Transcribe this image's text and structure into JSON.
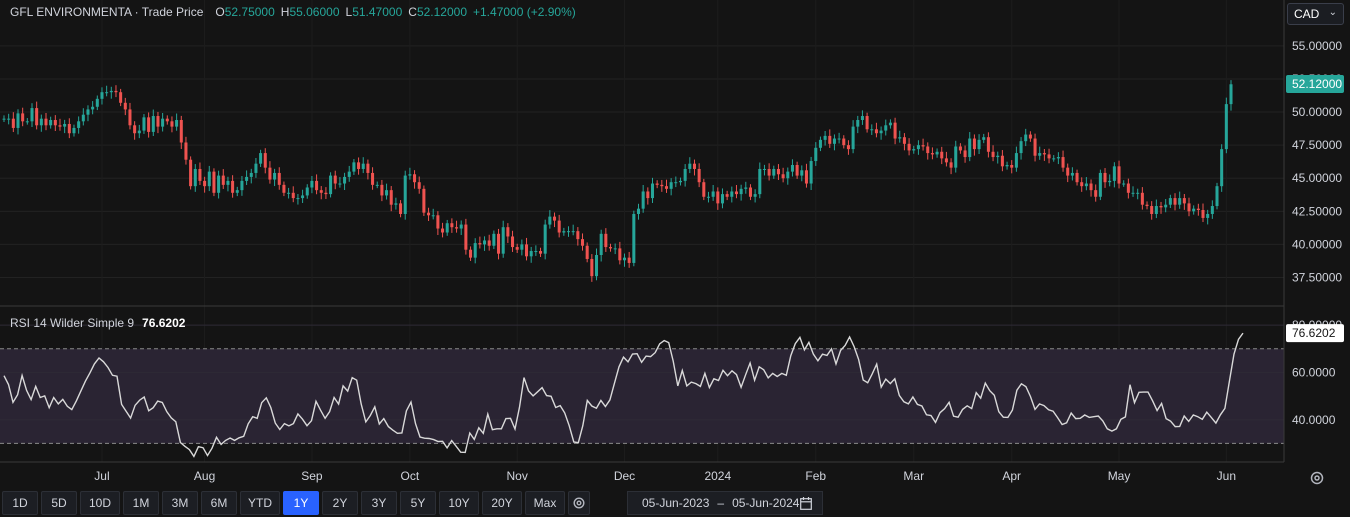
{
  "legend": {
    "name": "GFL ENVIRONMENTA · Trade Price",
    "o_label": "O",
    "o": "52.75000",
    "h_label": "H",
    "h": "55.06000",
    "l_label": "L",
    "l": "51.47000",
    "c_label": "C",
    "c": "52.12000",
    "change": "+1.47000 (+2.90%)"
  },
  "currency": {
    "selected": "CAD"
  },
  "rsi_legend": {
    "name": "RSI 14 Wilder Simple 9",
    "value": "76.6202"
  },
  "colors": {
    "up": "#26a69a",
    "down": "#ef5350",
    "rsi_line": "#d9d9d9",
    "rsi_band": "#2a2433",
    "background": "#141414",
    "grid": "#222222"
  },
  "toolbar": {
    "ranges": [
      "1D",
      "5D",
      "10D",
      "1M",
      "3M",
      "6M",
      "YTD",
      "1Y",
      "2Y",
      "3Y",
      "5Y",
      "10Y",
      "20Y",
      "Max"
    ],
    "active": "1Y",
    "settings_icon": "gear-icon",
    "date_from": "05-Jun-2023",
    "date_sep": "–",
    "date_to": "05-Jun-2024",
    "calendar_icon": "calendar-icon"
  },
  "chart_data": [
    {
      "type": "candlestick",
      "title": "GFL ENVIRONMENTA · Trade Price",
      "y_ticks": [
        "55.00000",
        "52.50000",
        "50.00000",
        "47.50000",
        "45.00000",
        "42.50000",
        "40.00000",
        "37.50000"
      ],
      "y_tick_values": [
        55,
        52.5,
        50,
        47.5,
        45,
        42.5,
        40,
        37.5
      ],
      "ylim": [
        35.8,
        56.2
      ],
      "last_price_label": "52.12000",
      "last_price": 52.12,
      "x_ticks": [
        "Jul",
        "Aug",
        "Sep",
        "Oct",
        "Nov",
        "Dec",
        "2024",
        "Feb",
        "Mar",
        "Apr",
        "May",
        "Jun"
      ],
      "x_tick_index": [
        21,
        43,
        66,
        87,
        110,
        133,
        153,
        174,
        195,
        216,
        239,
        262
      ],
      "close": [
        49.5,
        49.5,
        48.8,
        49.9,
        49.3,
        49.3,
        50.3,
        49.0,
        49.5,
        49.0,
        49.4,
        49.0,
        48.9,
        49.1,
        48.4,
        48.8,
        49.3,
        49.8,
        50.2,
        50.4,
        51.0,
        51.5,
        51.5,
        51.6,
        51.5,
        50.7,
        50.2,
        49.0,
        48.4,
        48.6,
        49.6,
        48.5,
        49.7,
        48.9,
        49.5,
        49.3,
        48.9,
        49.4,
        47.7,
        46.4,
        44.4,
        45.7,
        44.8,
        44.4,
        45.5,
        43.9,
        45.2,
        44.5,
        44.8,
        43.9,
        44.1,
        44.8,
        45.1,
        45.4,
        46.1,
        46.9,
        45.8,
        44.9,
        45.4,
        44.5,
        43.9,
        43.9,
        43.5,
        43.5,
        43.7,
        44.3,
        44.8,
        44.1,
        43.9,
        43.8,
        45.2,
        44.6,
        44.6,
        45.1,
        45.5,
        46.2,
        45.7,
        46.1,
        45.4,
        44.5,
        44.5,
        43.7,
        44.1,
        43.0,
        43.1,
        42.3,
        45.2,
        45.3,
        44.7,
        44.2,
        42.4,
        42.2,
        42.2,
        41.2,
        40.9,
        41.6,
        41.3,
        41.2,
        41.5,
        39.6,
        39.0,
        40.1,
        40.0,
        40.3,
        39.9,
        40.8,
        39.3,
        41.3,
        40.6,
        39.8,
        39.6,
        40.0,
        39.1,
        39.5,
        39.5,
        39.3,
        41.5,
        42.1,
        41.8,
        40.9,
        41.0,
        41.0,
        41.0,
        40.4,
        39.9,
        38.9,
        37.6,
        39.2,
        40.8,
        39.8,
        39.7,
        39.7,
        38.8,
        39.0,
        38.6,
        42.3,
        42.7,
        44.0,
        43.5,
        44.6,
        44.5,
        44.4,
        44.2,
        44.7,
        44.7,
        44.8,
        45.7,
        46.1,
        45.7,
        44.7,
        43.6,
        43.6,
        44.0,
        43.1,
        43.8,
        43.6,
        44.0,
        43.8,
        44.2,
        44.3,
        43.6,
        43.8,
        45.7,
        45.7,
        45.2,
        45.7,
        45.3,
        45.0,
        45.5,
        46.0,
        45.2,
        45.6,
        44.6,
        46.3,
        47.3,
        47.9,
        48.2,
        47.6,
        48.0,
        48.0,
        47.5,
        47.2,
        48.9,
        49.4,
        49.7,
        48.7,
        48.7,
        48.4,
        48.6,
        49.0,
        49.2,
        48.0,
        48.1,
        47.6,
        47.1,
        47.2,
        47.5,
        47.4,
        46.9,
        46.8,
        47.0,
        46.5,
        46.2,
        45.8,
        47.4,
        47.1,
        46.6,
        48.0,
        47.2,
        47.9,
        48.1,
        47.0,
        46.6,
        46.7,
        45.9,
        46.0,
        45.8,
        46.9,
        47.8,
        48.3,
        48.0,
        46.7,
        46.9,
        46.8,
        46.5,
        46.5,
        46.6,
        45.8,
        45.2,
        45.4,
        44.7,
        44.4,
        44.6,
        44.1,
        43.6,
        45.4,
        44.7,
        44.8,
        45.9,
        44.6,
        44.6,
        43.9,
        43.9,
        43.9,
        43.0,
        42.9,
        42.3,
        42.9,
        42.8,
        43.0,
        43.5,
        43.0,
        43.5,
        43.1,
        42.5,
        42.7,
        42.6,
        42.0,
        42.3,
        42.9,
        44.4,
        47.2,
        50.6,
        52.1
      ]
    },
    {
      "type": "line",
      "title": "RSI 14 Wilder Simple 9",
      "value_label": "76.6202",
      "y_ticks": [
        "80.00000",
        "60.0000",
        "40.0000"
      ],
      "y_tick_values": [
        80,
        60,
        40
      ],
      "ylim": [
        23,
        83
      ],
      "bands": [
        70,
        30
      ],
      "values": [
        58.6,
        54.9,
        47.4,
        50.6,
        58.7,
        52.4,
        48.5,
        54.1,
        49.4,
        50.1,
        45.1,
        49.4,
        46.7,
        48.6,
        45.7,
        44.3,
        48.0,
        52.2,
        56.3,
        59.8,
        63.6,
        66.1,
        64.5,
        62.1,
        58.8,
        58.4,
        46.5,
        43.6,
        40.7,
        46.1,
        48.3,
        49.6,
        43.8,
        45.1,
        47.9,
        47.3,
        43.4,
        40.8,
        39.2,
        30.4,
        28.8,
        27.4,
        24.5,
        28.6,
        28.2,
        24.9,
        28.0,
        32.6,
        29.6,
        31.3,
        32.3,
        31.3,
        32.4,
        33.0,
        38.3,
        41.3,
        40.6,
        47.2,
        49.3,
        45.2,
        38.6,
        35.9,
        38.4,
        37.4,
        38.4,
        42.5,
        40.3,
        37.5,
        39.6,
        47.8,
        44.1,
        40.6,
        43.4,
        49.4,
        46.6,
        54.3,
        52.1,
        57.8,
        56.7,
        46.6,
        39.1,
        41.8,
        45.5,
        38.2,
        40.5,
        37.1,
        35.6,
        34.3,
        34.4,
        43.8,
        47.5,
        38.4,
        32.7,
        32.2,
        32.1,
        31.6,
        30.8,
        30.9,
        28.1,
        31.2,
        28.8,
        26.3,
        26.2,
        34.4,
        31.7,
        36.6,
        34.3,
        42.4,
        35.8,
        36.2,
        36.2,
        40.5,
        40.6,
        36.1,
        45.3,
        57.8,
        52.2,
        50.1,
        51.8,
        53.6,
        50.2,
        49.9,
        45.2,
        46.0,
        42.9,
        37.5,
        30.6,
        30.3,
        37.5,
        48.2,
        45.8,
        44.9,
        48.2,
        45.6,
        48.4,
        55.5,
        62.4,
        66.5,
        64.5,
        67.8,
        67.9,
        64.3,
        66.9,
        66.7,
        68.4,
        72.1,
        73.5,
        72.6,
        64.8,
        54.3,
        60.8,
        54.3,
        55.9,
        55.3,
        54.1,
        59.6,
        53.6,
        57.3,
        56.6,
        60.9,
        58.6,
        60.7,
        59.1,
        53.7,
        59.0,
        64.0,
        56.7,
        62.4,
        61.1,
        57.7,
        59.6,
        58.3,
        59.6,
        58.8,
        67.1,
        72.2,
        74.8,
        69.5,
        72.7,
        67.7,
        64.9,
        67.7,
        67.2,
        70.0,
        63.6,
        69.3,
        71.4,
        75.0,
        70.9,
        65.5,
        56.8,
        55.6,
        59.4,
        63.5,
        53.8,
        57.2,
        55.3,
        57.3,
        50.3,
        47.6,
        46.7,
        49.6,
        46.5,
        45.8,
        42.1,
        41.8,
        38.9,
        43.0,
        44.7,
        47.4,
        41.5,
        41.1,
        44.4,
        45.9,
        44.7,
        51.5,
        49.1,
        55.5,
        52.3,
        50.4,
        43.4,
        41.1,
        41.0,
        44.1,
        52.5,
        55.2,
        54.0,
        49.8,
        44.4,
        46.7,
        46.0,
        44.2,
        43.6,
        40.9,
        38.0,
        38.7,
        42.8,
        40.5,
        40.6,
        42.0,
        41.0,
        41.3,
        41.6,
        39.5,
        36.2,
        35.2,
        36.2,
        40.2,
        41.2,
        54.8,
        47.2,
        51.6,
        51.7,
        51.7,
        48.0,
        43.9,
        46.9,
        40.5,
        39.4,
        37.1,
        37.2,
        41.6,
        39.3,
        42.0,
        41.3,
        40.2,
        43.2,
        41.0,
        38.6,
        42.1,
        44.8,
        56.3,
        67.8,
        74.0,
        76.6
      ]
    }
  ]
}
